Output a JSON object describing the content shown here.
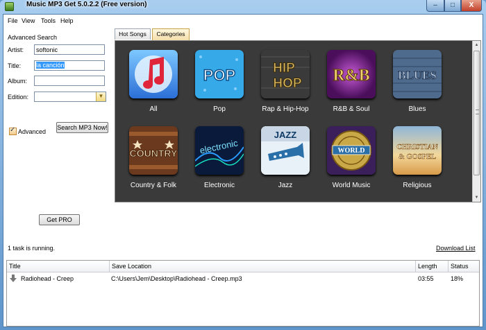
{
  "window": {
    "title": "Music MP3 Get  5.0.2.2  (Free version)",
    "controls": {
      "minimize": "–",
      "maximize": "□",
      "close": "X"
    }
  },
  "menu": [
    "File",
    "View",
    "Tools",
    "Help"
  ],
  "search": {
    "heading": "Advanced Search",
    "artist_label": "Artist:",
    "artist_value": "softonic",
    "title_label": "Title:",
    "title_value": "la canción",
    "album_label": "Album:",
    "album_value": "",
    "edition_label": "Edition:",
    "edition_value": "",
    "advanced_label": "Advanced",
    "advanced_checked": true,
    "search_button": "Search MP3 Now!",
    "get_pro_button": "Get PRO"
  },
  "tabs": [
    {
      "label": "Hot Songs",
      "active": false
    },
    {
      "label": "Categories",
      "active": true
    }
  ],
  "categories": [
    {
      "label": "All",
      "icon": "music-note-icon"
    },
    {
      "label": "Pop",
      "icon": "pop-icon"
    },
    {
      "label": "Rap & Hip-Hop",
      "icon": "hiphop-icon"
    },
    {
      "label": "R&B & Soul",
      "icon": "rnb-icon"
    },
    {
      "label": "Blues",
      "icon": "blues-icon"
    },
    {
      "label": "Country & Folk",
      "icon": "country-icon"
    },
    {
      "label": "Electronic",
      "icon": "electronic-icon"
    },
    {
      "label": "Jazz",
      "icon": "jazz-icon"
    },
    {
      "label": "World Music",
      "icon": "world-icon"
    },
    {
      "label": "Religious",
      "icon": "religious-icon"
    }
  ],
  "art_text": {
    "pop": "POP",
    "hiphop_1": "HIP",
    "hiphop_2": "HOP",
    "rnb": "R&B",
    "blues": "BLUES",
    "country": "COUNTRY",
    "electronic": "electronic",
    "jazz": "JAZZ",
    "world": "WORLD",
    "religious_1": "CHRISTIAN",
    "religious_2": "& GOSPEL"
  },
  "status": {
    "tasks": "1 task is running.",
    "download_list_link": "Download List"
  },
  "downloads": {
    "columns": [
      "Title",
      "Save Location",
      "Length",
      "Status"
    ],
    "rows": [
      {
        "title": "Radiohead - Creep",
        "location": "C:\\Users\\Jem\\Desktop\\Radiohead - Creep.mp3",
        "length": "03:55",
        "status": "18%"
      }
    ]
  },
  "colors": {
    "gallery_bg": "#3a3a3a",
    "active_tab": "#f5deab",
    "selection": "#3399ff"
  }
}
